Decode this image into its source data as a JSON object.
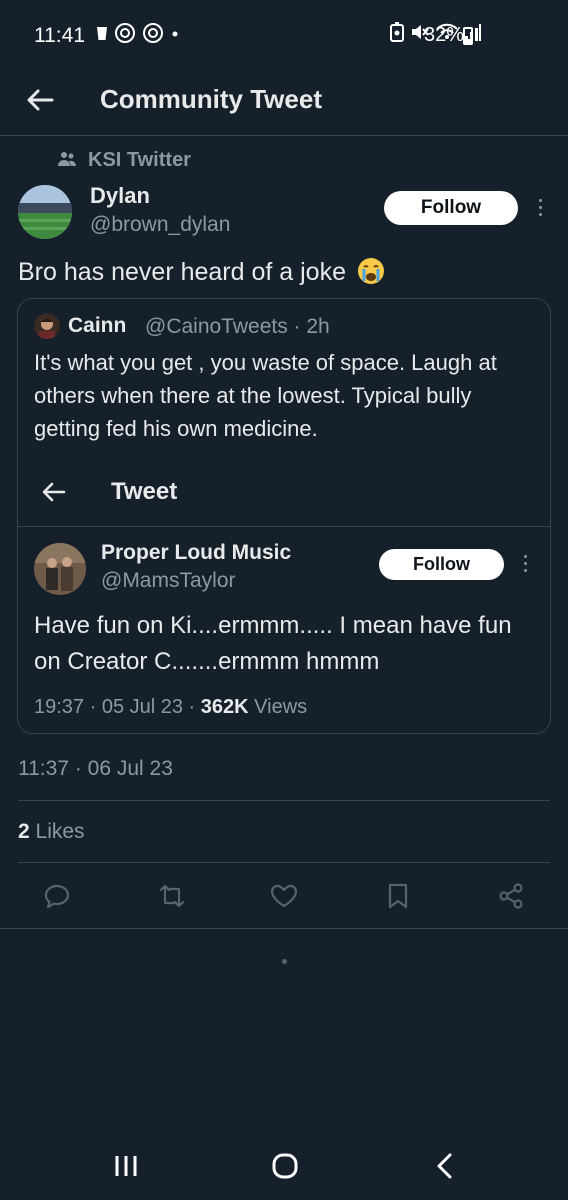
{
  "status_bar": {
    "time": "11:41",
    "battery": "32%",
    "battery_level": 0.32
  },
  "header": {
    "title": "Community Tweet"
  },
  "community": {
    "name": "KSI Twitter"
  },
  "tweet": {
    "author_name": "Dylan",
    "author_handle": "@brown_dylan",
    "follow_label": "Follow",
    "text": "Bro has never heard of a joke",
    "timestamp": "11:37 · 06 Jul 23",
    "likes_count": "2",
    "likes_label": "Likes"
  },
  "quote": {
    "author_name": "Cainn",
    "meta": "@CainoTweets · 2h",
    "text": "It's what you get , you waste of space. Laugh at others when there at the lowest. Typical bully getting fed his own medicine.",
    "inner_header": "Tweet",
    "inner": {
      "author_name": "Proper Loud Music",
      "author_handle": "@MamsTaylor",
      "follow_label": "Follow",
      "text": "Have fun on Ki....ermmm..... I mean have fun on Creator C.......ermmm hmmm",
      "time": "19:37 · 05 Jul 23 · ",
      "views_count": "362K",
      "views_label": " Views"
    }
  },
  "colors": {
    "background": "#15202b",
    "secondary_text": "#8b98a5",
    "border": "#38444d"
  }
}
